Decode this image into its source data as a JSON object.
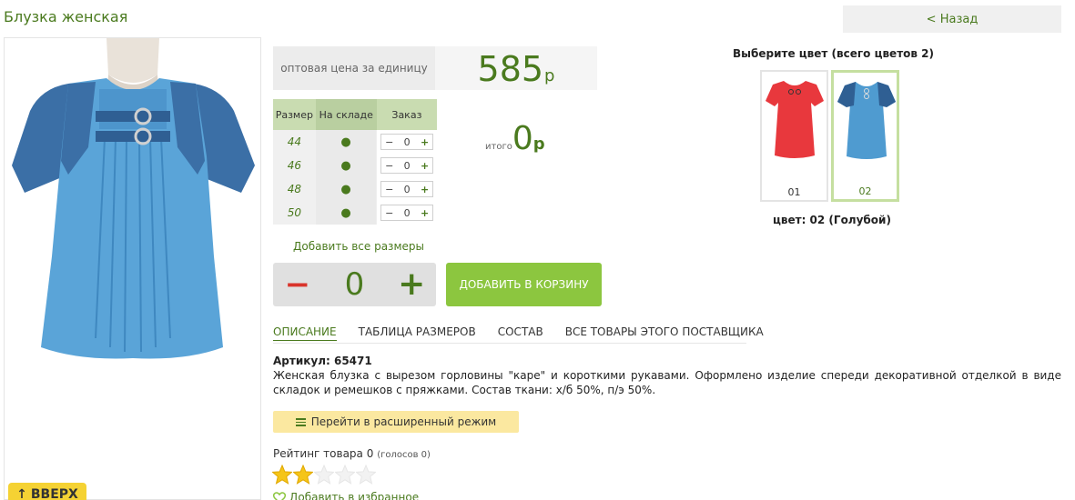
{
  "page": {
    "title": "Блузка женская",
    "back_label": "< Назад",
    "top_button": "ВВЕРХ"
  },
  "price": {
    "label": "оптовая цена за единицу",
    "value": "585",
    "currency": "р"
  },
  "sizes_table": {
    "headers": [
      "Размер",
      "На складе",
      "Заказ"
    ],
    "rows": [
      {
        "size": "44",
        "in_stock": "●",
        "qty": "0"
      },
      {
        "size": "46",
        "in_stock": "●",
        "qty": "0"
      },
      {
        "size": "48",
        "in_stock": "●",
        "qty": "0"
      },
      {
        "size": "50",
        "in_stock": "●",
        "qty": "0"
      }
    ],
    "minus": "−",
    "plus": "+"
  },
  "total": {
    "label": "итого",
    "value": "0",
    "currency": "р"
  },
  "add_all_sizes": "Добавить все размеры",
  "quantity": {
    "minus": "−",
    "value": "0",
    "plus": "+"
  },
  "add_to_cart": "ДОБАВИТЬ В КОРЗИНУ",
  "tabs": [
    "ОПИСАНИЕ",
    "ТАБЛИЦА РАЗМЕРОВ",
    "СОСТАВ",
    "ВСЕ ТОВАРЫ ЭТОГО ПОСТАВЩИКА"
  ],
  "article": "Артикул: 65471",
  "description": "Женская блузка с вырезом горловины \"каре\" и короткими рукавами. Оформлено изделие спереди декоративной отделкой в виде складок и ремешков с пряжками. Состав ткани: х/б 50%, п/э 50%.",
  "extended_mode": "Перейти в расширенный режим",
  "rating": {
    "label": "Рейтинг товара 0",
    "votes": "(голосов 0)",
    "stars_filled": 2,
    "stars_total": 5
  },
  "favorite": "Добавить в избранное",
  "colors": {
    "title": "Выберите цвет (всего цветов 2)",
    "items": [
      {
        "code": "01",
        "color": "#e8383d"
      },
      {
        "code": "02",
        "color": "#4f9bd0"
      }
    ],
    "selected": "цвет: 02 (Голубой)"
  },
  "theme": {
    "accent": "#4a7a1e",
    "button_green": "#8cc63f",
    "minus_red": "#d9342b",
    "highlight_yellow": "#fbe8a0"
  },
  "icons": {
    "extended_mode": "list-icon",
    "favorite": "heart-icon",
    "top": "arrow-up-icon",
    "star": "star-icon"
  }
}
